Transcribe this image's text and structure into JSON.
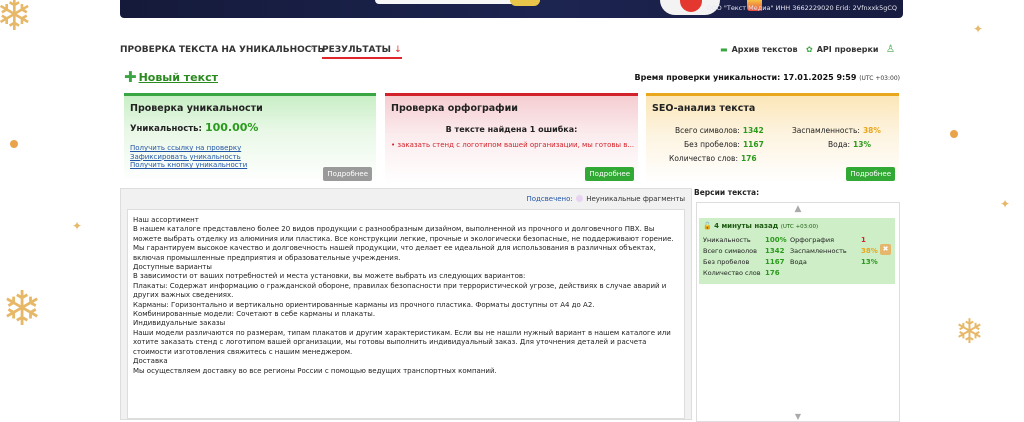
{
  "banner": {
    "company_info": "ООО \"Текст Медиа\" ИНН 3662229020 Erid: 2Vfnxxk5gCQ"
  },
  "nav": {
    "crumb_check": "ПРОВЕРКА ТЕКСТА НА УНИКАЛЬНОСТЬ",
    "crumb_sep": "›",
    "crumb_results": "РЕЗУЛЬТАТЫ",
    "archive": "Архив текстов",
    "api": "API проверки"
  },
  "new_text": "Новый текст",
  "check_time": {
    "label": "Время проверки уникальности:",
    "value": "17.01.2025 9:59",
    "tz": "(UTC +03:00)"
  },
  "uniqueness_card": {
    "title": "Проверка уникальности",
    "label": "Уникальность:",
    "value": "100.00%",
    "links": [
      "Получить ссылку на проверку",
      "Зафиксировать уникальность",
      "Получить кнопку уникальности"
    ],
    "more": "Подробнее"
  },
  "spelling_card": {
    "title": "Проверка орфографии",
    "found": "В тексте найдена 1 ошибка:",
    "error": "• заказать стенд с логотипом вашей организации, мы готовы в...",
    "more": "Подробнее"
  },
  "seo_card": {
    "title": "SEO-анализ текста",
    "chars_label": "Всего символов:",
    "chars": "1342",
    "nospace_label": "Без пробелов:",
    "nospace": "1167",
    "words_label": "Количество слов:",
    "words": "176",
    "spam_label": "Заспамленность:",
    "spam": "38%",
    "water_label": "Вода:",
    "water": "13%",
    "more": "Подробнее"
  },
  "legend": {
    "highlighted": "Подсвечено:",
    "nonunique": "Неуникальные фрагменты"
  },
  "text_lines": [
    "Наш ассортимент",
    "В нашем каталоге представлено более 20 видов продукции с разнообразным дизайном, выполненной из прочного и долговечного ПВХ. Вы можете выбрать отделку из алюминия или пластика. Все конструкции легкие, прочные и экологически безопасные, не поддерживают горение. Мы гарантируем высокое качество и долговечность нашей продукции, что делает ее идеальной для использования в различных объектах, включая промышленные предприятия и образовательные учреждения.",
    "Доступные варианты",
    "В зависимости от ваших потребностей и места установки, вы можете выбрать из следующих вариантов:",
    "Плакаты: Содержат информацию о гражданской обороне, правилах безопасности при террористической угрозе, действиях в случае аварий и других важных сведениях.",
    "Карманы: Горизонтально и вертикально ориентированные карманы из прочного пластика. Форматы доступны от А4 до А2.",
    "Комбинированные модели: Сочетают в себе карманы и плакаты.",
    "Индивидуальные заказы",
    "Наши модели различаются по размерам, типам плакатов и другим характеристикам. Если вы не нашли нужный вариант в нашем каталоге или хотите заказать стенд с логотипом вашей организации, мы готовы выполнить индивидуальный заказ. Для уточнения деталей и расчета стоимости изготовления свяжитесь с нашим менеджером.",
    "Доставка",
    "Мы осуществляем доставку во все регионы России с помощью ведущих транспортных компаний."
  ],
  "versions": {
    "title": "Версии текста:",
    "item": {
      "time": "4 минуты назад",
      "tz": "(UTC +03:00)",
      "uniq_label": "Уникальность",
      "uniq": "100%",
      "chars_label": "Всего символов",
      "chars": "1342",
      "nospace_label": "Без пробелов",
      "nospace": "1167",
      "words_label": "Количество слов",
      "words": "176",
      "spell_label": "Орфография",
      "spell": "1",
      "spam_label": "Заспамленность",
      "spam": "38%",
      "water_label": "Вода",
      "water": "13%"
    }
  },
  "colors": {
    "green": "#3aa543",
    "red": "#d2232a",
    "orange": "#e8a71d",
    "link": "#2456a8"
  }
}
